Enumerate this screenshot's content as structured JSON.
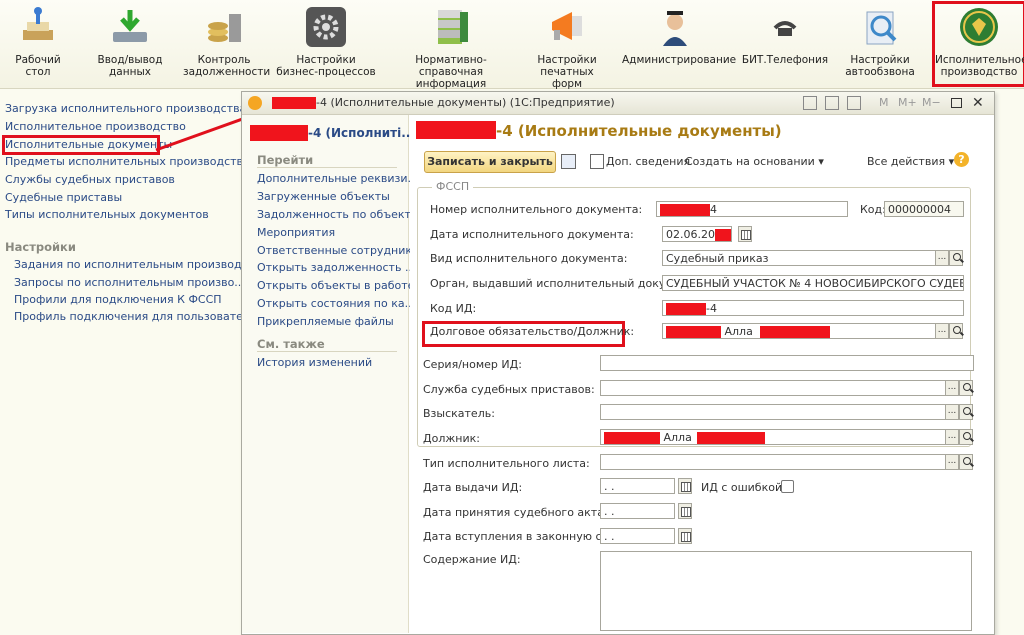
{
  "toolbar": {
    "items": [
      {
        "label": "Рабочий\nстол",
        "icon": "desktop-icon"
      },
      {
        "label": "Ввод/вывод\nданных",
        "icon": "data-io-icon"
      },
      {
        "label": "Контроль\nзадолженности",
        "icon": "debt-control-icon"
      },
      {
        "label": "Настройки\nбизнес-процессов",
        "icon": "business-process-icon"
      },
      {
        "label": "Нормативно-справочная\nинформация",
        "icon": "reference-info-icon"
      },
      {
        "label": "Настройки\nпечатных форм",
        "icon": "print-forms-icon"
      },
      {
        "label": "Администрирование",
        "icon": "admin-icon"
      },
      {
        "label": "БИТ.Телефония",
        "icon": "phone-icon"
      },
      {
        "label": "Настройки\nавтообзвона",
        "icon": "autodial-icon"
      },
      {
        "label": "Исполнительное\nпроизводство",
        "icon": "fssp-emblem-icon"
      }
    ]
  },
  "sidebar": {
    "items": [
      "Загрузка исполнительного производства",
      "Исполнительное производство",
      "Исполнительные документы",
      "Предметы исполнительных производств",
      "Службы судебных приставов",
      "Судебные приставы",
      "Типы исполнительных документов"
    ],
    "settings_header": "Настройки",
    "settings_items": [
      "Задания по исполнительным производ...",
      "Запросы по исполнительным произво...",
      "Профили для подключения К ФССП",
      "Профиль подключения для пользовате..."
    ]
  },
  "window": {
    "title": "-4 (Исполнительные документы)  (1С:Предприятие)",
    "tools": [
      "M",
      "M+",
      "M−"
    ],
    "nav_title": "-4 (Исполниті...",
    "goto_header": "Перейти",
    "goto_items": [
      "Дополнительные реквизи...",
      "Загруженные объекты",
      "Задолженность по объект...",
      "Мероприятия",
      "Ответственные сотрудники",
      "Открыть задолженность ...",
      "Открыть объекты в работе",
      "Открыть состояния по ка...",
      "Прикрепляемые файлы"
    ],
    "see_also_header": "См. также",
    "see_also_items": [
      "История изменений"
    ]
  },
  "form": {
    "title": "-4 (Исполнительные документы)",
    "save_close": "Записать и закрыть",
    "extra_info": "Доп. сведения",
    "create_based": "Создать на основании",
    "all_actions": "Все действия",
    "help": "?",
    "group_title": "ФССП",
    "doc_number_label": "Номер исполнительного документа:",
    "doc_number_value": "4",
    "code_label": "Код:",
    "code_value": "000000004",
    "doc_date_label": "Дата исполнительного документа:",
    "doc_date_value": "02.06.20",
    "doc_type_label": "Вид исполнительного документа:",
    "doc_type_value": "Судебный приказ",
    "organ_label": "Орган, выдавший исполнительный документ:",
    "organ_value": "СУДЕБНЫЙ УЧАСТОК № 4 НОВОСИБИРСКОГО СУДЕБН",
    "code_id_label": "Код ИД:",
    "code_id_value": "-4",
    "debt_label": "Долговое обязательство/Должник:",
    "debt_value": "Алла",
    "series_label": "Серия/номер ИД:",
    "service_label": "Служба судебных приставов:",
    "claimant_label": "Взыскатель:",
    "debtor_label": "Должник:",
    "debtor_value": "Алла",
    "sheet_type_label": "Тип исполнительного листа:",
    "issue_date_label": "Дата выдачи ИД:",
    "error_label": "ИД с ошибкой:",
    "accept_date_label": "Дата принятия судебного акта:",
    "effective_date_label": "Дата вступления в законную силу:",
    "content_label": "Содержание ИД:",
    "empty_date": " .  ."
  }
}
